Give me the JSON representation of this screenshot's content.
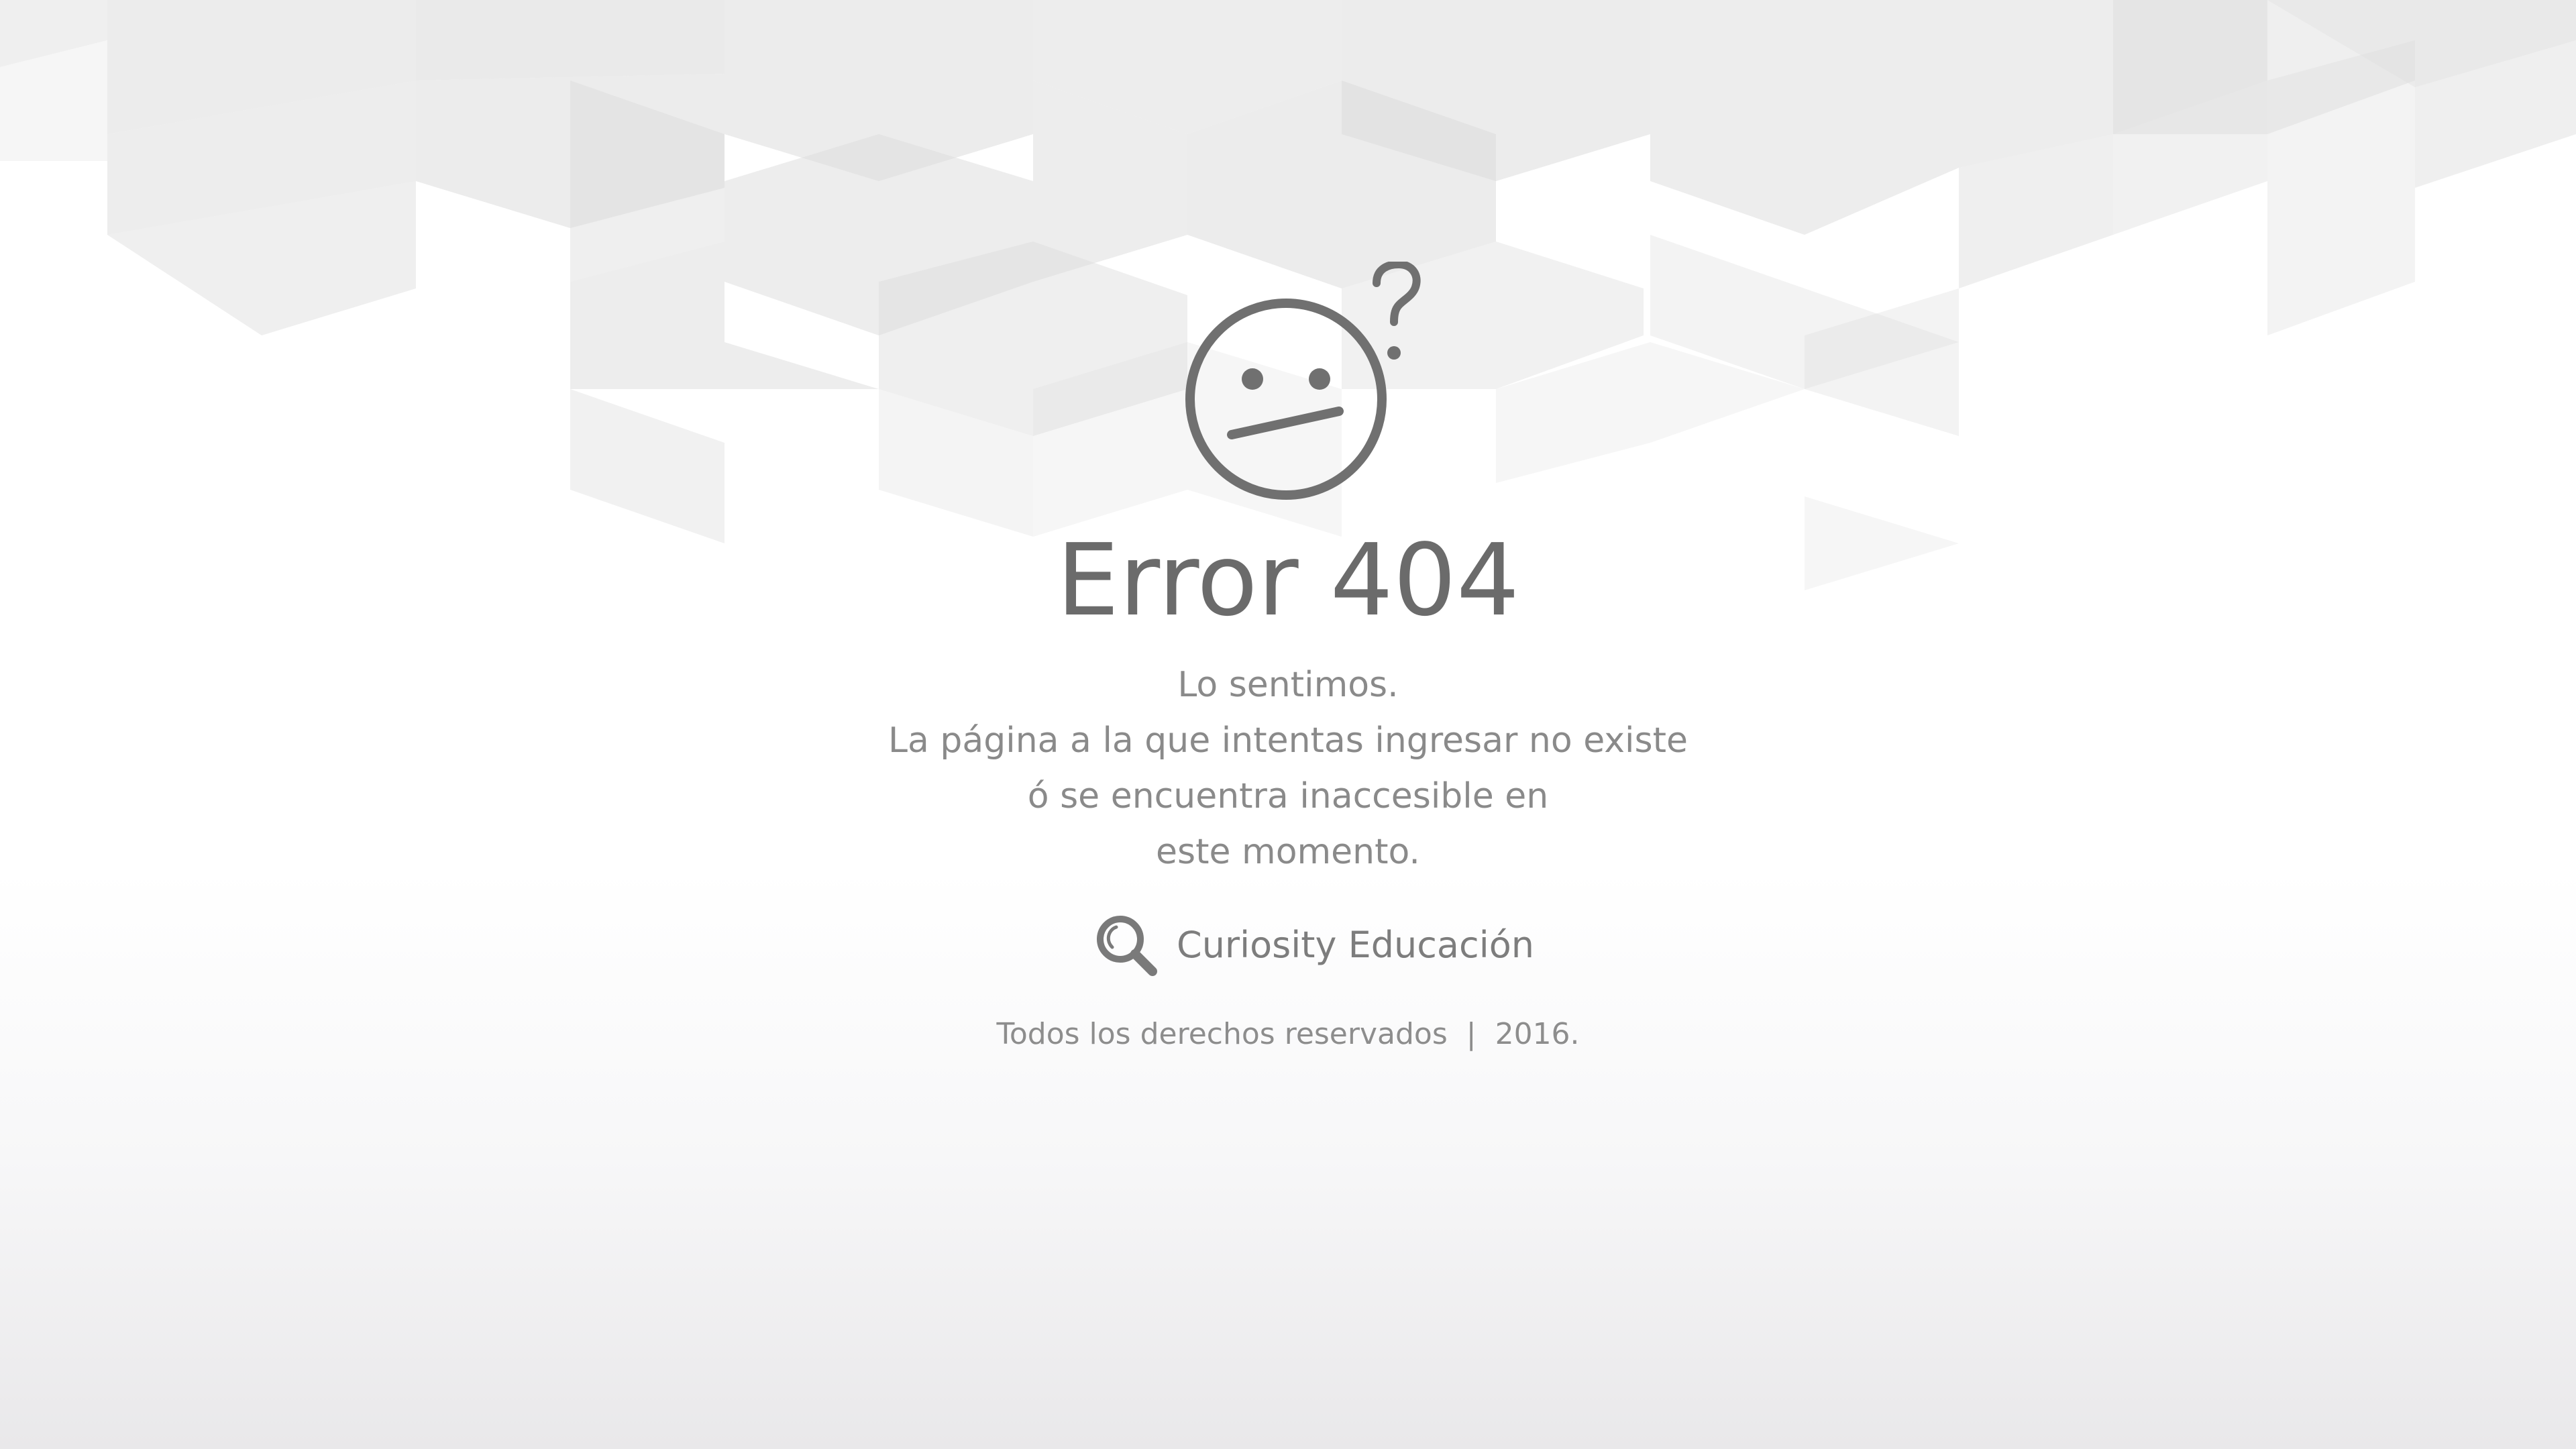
{
  "error": {
    "title": "Error 404",
    "message_lines": [
      "Lo sentimos.",
      "La página a la que intentas ingresar no existe",
      "ó se encuentra inaccesible en",
      "este momento."
    ],
    "icon": "confused-face-icon"
  },
  "brand": {
    "name": "Curiosity Educación",
    "icon": "magnifier-logo-icon"
  },
  "footer": {
    "rights": "Todos los derechos reservados",
    "separator": "|",
    "year": "2016."
  },
  "colors": {
    "text_dark": "#6b6b6b",
    "text_light": "#8a8a8a",
    "pattern": "#e6e6e6"
  }
}
